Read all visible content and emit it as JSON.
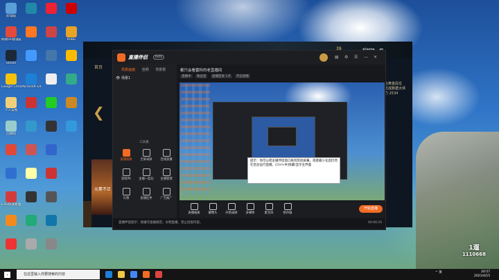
{
  "desktop": {
    "icons": [
      {
        "label": "此电脑",
        "color": "#5a9fd8"
      },
      {
        "label": "网易UU加速器",
        "color": "#e24a3b"
      },
      {
        "label": "Steam",
        "color": "#1b2838"
      },
      {
        "label": "Google Chrome",
        "color": "#f4c20d"
      },
      {
        "label": "个人常用",
        "color": "#f0d07a"
      },
      {
        "label": "回收站",
        "color": "#9cc"
      },
      {
        "label": "",
        "color": "#e04838"
      },
      {
        "label": "",
        "color": "#2f6fcf"
      },
      {
        "label": "CAD快速看图",
        "color": "#d23c3c"
      },
      {
        "label": "",
        "color": "#f28a1e"
      },
      {
        "label": "",
        "color": "#e33"
      },
      {
        "label": "",
        "color": "#28a"
      },
      {
        "label": "",
        "color": "#f72"
      },
      {
        "label": "",
        "color": "#49f"
      },
      {
        "label": "Microsoft Edge",
        "color": "#1e7fd6"
      },
      {
        "label": "",
        "color": "#c33"
      },
      {
        "label": "",
        "color": "#39c"
      },
      {
        "label": "",
        "color": "#c55"
      },
      {
        "label": "",
        "color": "#ffa"
      },
      {
        "label": "",
        "color": "#333"
      },
      {
        "label": "",
        "color": "#2a7"
      },
      {
        "label": "",
        "color": "#aaa"
      },
      {
        "label": "",
        "color": "#e23"
      },
      {
        "label": "",
        "color": "#c44"
      },
      {
        "label": "",
        "color": "#47a"
      },
      {
        "label": "",
        "color": "#eee"
      },
      {
        "label": "",
        "color": "#2c2"
      },
      {
        "label": "",
        "color": "#333"
      },
      {
        "label": "",
        "color": "#36c"
      },
      {
        "label": "",
        "color": "#c33"
      },
      {
        "label": "",
        "color": "#555"
      },
      {
        "label": "",
        "color": "#17a"
      },
      {
        "label": "",
        "color": "#888"
      },
      {
        "label": "",
        "color": "#c00"
      },
      {
        "label": "PUBG",
        "color": "#e8a425"
      },
      {
        "label": "",
        "color": "#fb0"
      },
      {
        "label": "",
        "color": "#3a8"
      },
      {
        "label": "",
        "color": "#c82"
      },
      {
        "label": "",
        "color": "#39d"
      }
    ]
  },
  "launcher": {
    "nav": "首页",
    "user": "超越极一把",
    "badge": "39",
    "right_text": [
      "我在黄金段位",
      "已达成数据大师",
      "战力 2534"
    ],
    "caption": "元素不正"
  },
  "app": {
    "name": "直播伴侣",
    "version": "beta",
    "side_tabs": [
      "场景画面",
      "音频",
      "背景景"
    ],
    "scene": "场景1",
    "tool_title": "工具箱",
    "tools": [
      {
        "label": "直播画质",
        "hot": true
      },
      {
        "label": "全屏录屏",
        "hot": false
      },
      {
        "label": "连线直播",
        "hot": false
      },
      {
        "label": "游戏PK",
        "hot": false
      },
      {
        "label": "主播一起玩",
        "hot": false
      },
      {
        "label": "主播管理",
        "hot": false
      },
      {
        "label": "礼物",
        "hot": false
      },
      {
        "label": "直播挂件",
        "hot": false
      },
      {
        "label": "广告推广",
        "hot": false
      }
    ],
    "room_title": "都只会看雷科的老直播间",
    "room_tags": [
      "直播中",
      "粉丝团",
      "直播回放 1点",
      "开启观看"
    ],
    "tooltip": "提示：你可以把主播伴侣窗口拖到其他屏幕，或者最小化后仍然在后台运行直播。(Ctrl+M)隐藏/显示主界面",
    "bottom": [
      {
        "label": "直播画质"
      },
      {
        "label": "摄像头"
      },
      {
        "label": "开始录屏"
      },
      {
        "label": "多媒体"
      },
      {
        "label": "麦克风"
      },
      {
        "label": "扬声器"
      }
    ],
    "start_label": "开始直播",
    "status_notice": "直播伴侣提示：请遵守直播规范，文明直播，禁止低俗内容。",
    "status_time": "00:00:25"
  },
  "watermark": {
    "line1": "1遛",
    "line2": "1110668"
  },
  "taskbar": {
    "search_placeholder": "在这里输入你要搜索的内容",
    "tray": "^ 英",
    "time": "20:57",
    "date": "2021/4/15",
    "icons": [
      "#1e7fd6",
      "#f2c744",
      "#4287f5",
      "#f26b25",
      "#d44"
    ]
  }
}
